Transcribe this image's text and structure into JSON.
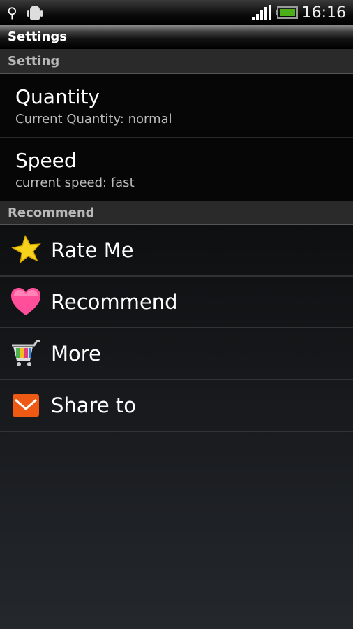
{
  "status_bar": {
    "time": "16:16",
    "icons": [
      "usb-icon",
      "android-debug-icon",
      "signal-icon",
      "battery-icon"
    ],
    "battery_color": "#4caf1a"
  },
  "title": "Settings",
  "sections": [
    {
      "header": "Setting",
      "prefs": [
        {
          "title": "Quantity",
          "summary": "Current Quantity: normal"
        },
        {
          "title": "Speed",
          "summary": "current speed: fast"
        }
      ]
    },
    {
      "header": "Recommend",
      "items": [
        {
          "label": "Rate Me",
          "icon": "star-icon"
        },
        {
          "label": "Recommend",
          "icon": "heart-icon"
        },
        {
          "label": "More",
          "icon": "shopping-cart-icon"
        },
        {
          "label": "Share to",
          "icon": "envelope-icon"
        }
      ]
    }
  ]
}
